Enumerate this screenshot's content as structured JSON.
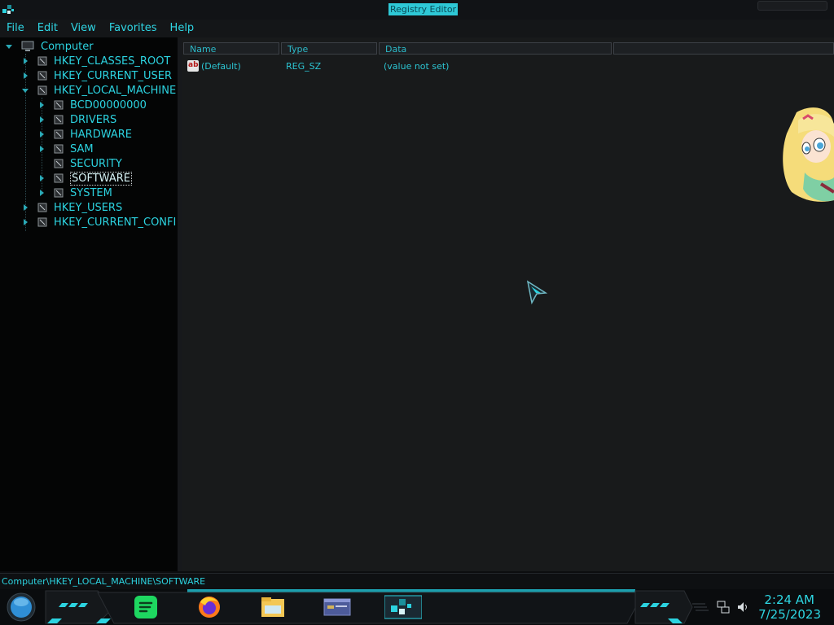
{
  "window": {
    "title": "Registry Editor"
  },
  "menu": [
    "File",
    "Edit",
    "View",
    "Favorites",
    "Help"
  ],
  "tree": {
    "root": "Computer",
    "hives": [
      {
        "label": "HKEY_CLASSES_ROOT"
      },
      {
        "label": "HKEY_CURRENT_USER"
      },
      {
        "label": "HKEY_LOCAL_MACHINE",
        "expanded": true,
        "children": [
          "BCD00000000",
          "DRIVERS",
          "HARDWARE",
          "SAM",
          "SECURITY",
          "SOFTWARE",
          "SYSTEM"
        ]
      },
      {
        "label": "HKEY_USERS"
      },
      {
        "label": "HKEY_CURRENT_CONFI"
      }
    ],
    "selected": "SOFTWARE"
  },
  "values": {
    "columns": [
      "Name",
      "Type",
      "Data"
    ],
    "rows": [
      {
        "name": "(Default)",
        "type": "REG_SZ",
        "data": "(value not set)",
        "icon": "string-value-icon"
      }
    ]
  },
  "status": {
    "path": "Computer\\HKEY_LOCAL_MACHINE\\SOFTWARE"
  },
  "taskbar": {
    "apps": [
      "spotify-icon",
      "firefox-icon",
      "file-explorer-icon",
      "window-app-icon",
      "registry-editor-icon"
    ],
    "tray": [
      "network-icon",
      "volume-icon"
    ],
    "clock": {
      "time": "2:24 AM",
      "date": "7/25/2023"
    }
  },
  "colors": {
    "accent": "#2cd3e0",
    "background": "#181a1b",
    "tree_bg": "#040505",
    "title_highlight": "#2ec8d6"
  }
}
